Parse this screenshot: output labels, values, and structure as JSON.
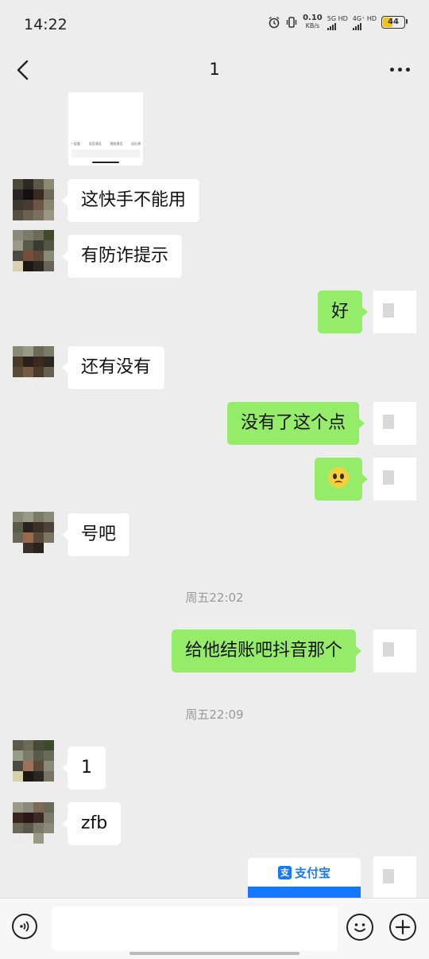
{
  "status_bar": {
    "time": "14:22",
    "net_speed_value": "0.10",
    "net_speed_unit": "KB/s",
    "sim1_label": "5G HD",
    "sim2_label": "4G⁺ HD",
    "battery": "44",
    "icons": [
      "alarm-icon",
      "vibrate-icon",
      "signal-icon",
      "battery-icon"
    ]
  },
  "nav": {
    "title": "1",
    "icons": [
      "back-icon",
      "more-icon"
    ]
  },
  "image_preview": {
    "toolbar_items": [
      "一起看",
      "语音通话",
      "视频通话",
      "送礼物"
    ],
    "input_placeholder": "输入消息"
  },
  "messages": [
    {
      "side": "left",
      "text": "这快手不能用"
    },
    {
      "side": "left",
      "text": "有防诈提示"
    },
    {
      "side": "right",
      "text": "好"
    },
    {
      "side": "left",
      "text": "还有没有"
    },
    {
      "side": "right",
      "text": "没有了这个点"
    },
    {
      "side": "right",
      "emoji": "pleading-face-emoji"
    },
    {
      "side": "left",
      "text": "号吧"
    },
    {
      "side": "right",
      "text": "给他结账吧抖音那个"
    },
    {
      "side": "left",
      "text": "1"
    },
    {
      "side": "left",
      "text": "zfb"
    }
  ],
  "time_separators": [
    "周五22:02",
    "周五22:09"
  ],
  "alipay_card": {
    "brand": "支付宝",
    "logo_char": "支",
    "brand_color": "#1677ff"
  },
  "input_bar": {
    "value": "",
    "icons": [
      "voice-icon",
      "emoji-icon",
      "plus-icon"
    ]
  },
  "colors": {
    "background": "#ededed",
    "my_bubble": "#95ec69",
    "their_bubble": "#ffffff"
  }
}
